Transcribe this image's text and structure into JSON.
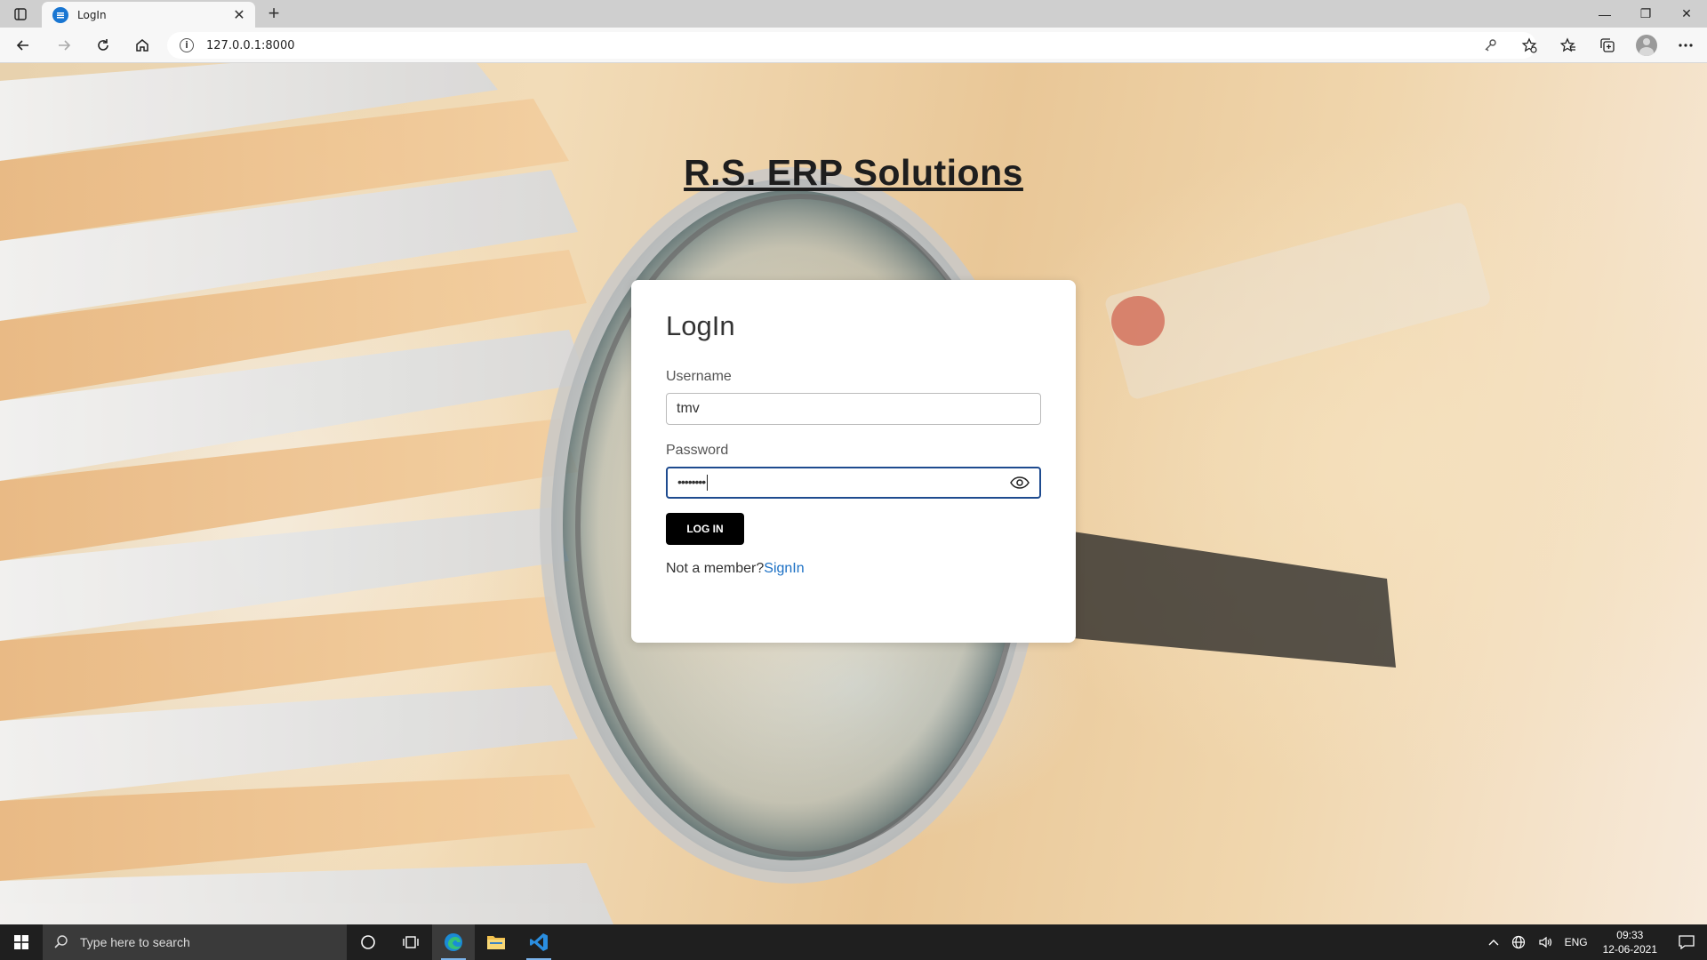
{
  "browser": {
    "tab_title": "LogIn",
    "tab_close": "✕",
    "new_tab": "+",
    "url": "127.0.0.1:8000",
    "window_controls": {
      "minimize": "—",
      "restore": "❐",
      "close": "✕"
    }
  },
  "page": {
    "heading": "R.S. ERP Solutions"
  },
  "login": {
    "title": "LogIn",
    "username_label": "Username",
    "username_value": "tmv",
    "password_label": "Password",
    "password_value": "••••••••",
    "submit_label": "LOG IN",
    "not_member_text": "Not a member?",
    "signin_link": "SignIn"
  },
  "taskbar": {
    "search_placeholder": "Type here to search",
    "language": "ENG",
    "time": "09:33",
    "date": "12-06-2021"
  },
  "colors": {
    "accent_link": "#1a6fc4",
    "button_bg": "#000000",
    "focus_border": "#1e4b8f"
  }
}
